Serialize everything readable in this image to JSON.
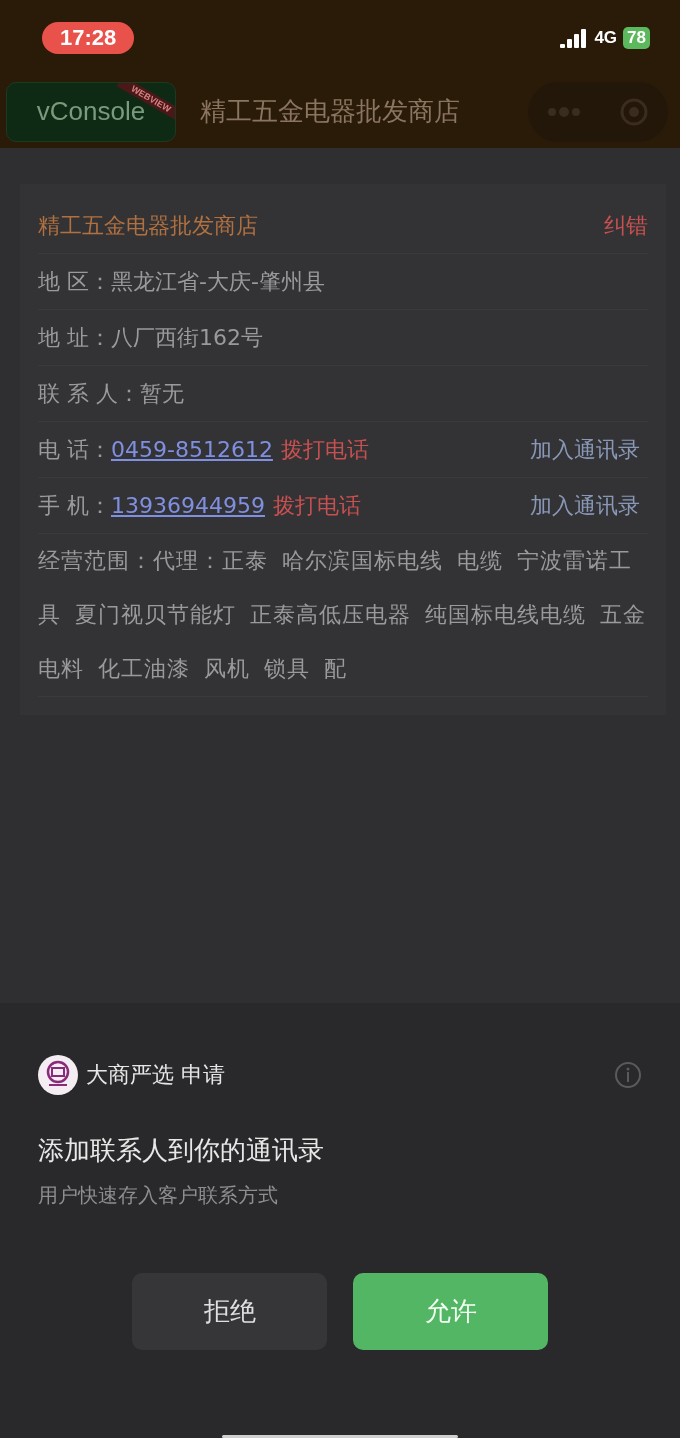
{
  "status_bar": {
    "time": "17:28",
    "network": "4G",
    "battery": "78"
  },
  "nav_bar": {
    "console_button": "vConsole",
    "console_ribbon": "WEBVIEW",
    "title": "精工五金电器批发商店"
  },
  "card": {
    "title": "精工五金电器批发商店",
    "report_link": "纠错",
    "rows": [
      {
        "kind": "text",
        "label": "地 区：",
        "value": "黑龙江省-大庆-肇州县"
      },
      {
        "kind": "text",
        "label": "地 址：",
        "value": "八厂西街162号"
      },
      {
        "kind": "text",
        "label": "联 系 人：",
        "value": "暂无"
      },
      {
        "kind": "phone",
        "label": "电 话：",
        "number": "0459-8512612",
        "call": "拨打电话",
        "add": "加入通讯录"
      },
      {
        "kind": "phone",
        "label": "手 机：",
        "number": "13936944959",
        "call": "拨打电话",
        "add": "加入通讯录"
      }
    ],
    "business_scope": "经营范围：代理：正泰 哈尔滨国标电线 电缆 宁波雷诺工具 夏门视贝节能灯 正泰高低压电器 纯国标电线电缆 五金电料 化工油漆 风机 锁具 配"
  },
  "permission_sheet": {
    "app_name": "大商严选",
    "request": "申请",
    "title": "添加联系人到你的通讯录",
    "description": "用户快速存入客户联系方式",
    "buttons": [
      {
        "label": "拒绝",
        "kind": "secondary"
      },
      {
        "label": "允许",
        "kind": "primary"
      }
    ]
  }
}
